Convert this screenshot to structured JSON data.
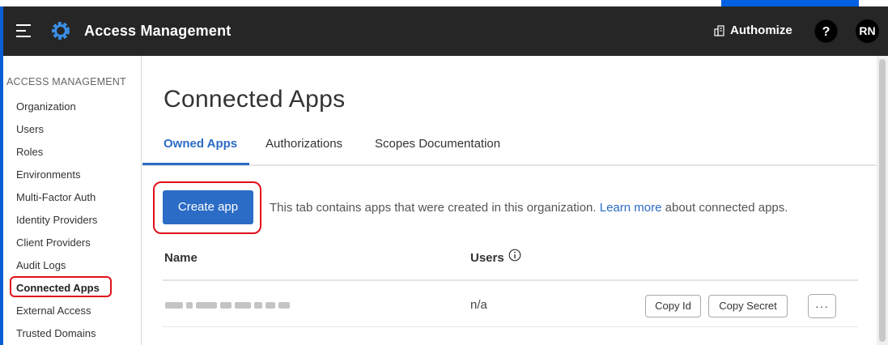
{
  "header": {
    "title": "Access Management",
    "authomize_label": "Authomize",
    "help_label": "?",
    "avatar_initials": "RN"
  },
  "sidebar": {
    "section_title": "ACCESS MANAGEMENT",
    "items": [
      {
        "label": "Organization"
      },
      {
        "label": "Users"
      },
      {
        "label": "Roles"
      },
      {
        "label": "Environments"
      },
      {
        "label": "Multi-Factor Auth"
      },
      {
        "label": "Identity Providers"
      },
      {
        "label": "Client Providers"
      },
      {
        "label": "Audit Logs"
      },
      {
        "label": "Connected Apps"
      },
      {
        "label": "External Access"
      },
      {
        "label": "Trusted Domains"
      }
    ],
    "active_item": "Connected Apps"
  },
  "main": {
    "page_title": "Connected Apps",
    "tabs": [
      {
        "label": "Owned Apps"
      },
      {
        "label": "Authorizations"
      },
      {
        "label": "Scopes Documentation"
      }
    ],
    "active_tab": "Owned Apps",
    "create_button_label": "Create app",
    "description_prefix": "This tab contains apps that were created in this organization.",
    "learn_more_label": "Learn more",
    "description_suffix": "about connected apps.",
    "table": {
      "columns": [
        {
          "label": "Name"
        },
        {
          "label": "Users"
        }
      ],
      "rows": [
        {
          "users": "n/a",
          "copy_id_label": "Copy Id",
          "copy_secret_label": "Copy Secret",
          "more_label": "···"
        }
      ]
    }
  },
  "colors": {
    "header_bg": "#262626",
    "accent": "#2b6cc6",
    "highlight_ring": "#e0101a"
  }
}
